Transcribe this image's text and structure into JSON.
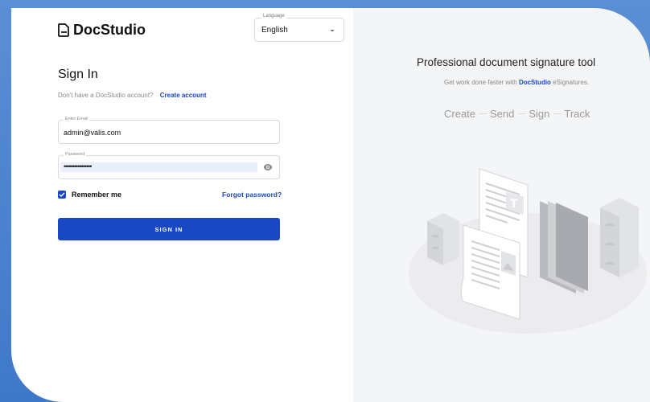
{
  "brand": {
    "name": "DocStudio"
  },
  "language": {
    "label": "Language",
    "value": "English"
  },
  "signin": {
    "title": "Sign In",
    "no_account_text": "Don't have a DocStudio account?",
    "create_account": "Create account",
    "email_label": "Enter Email",
    "email_value": "admin@valis.com",
    "password_label": "Password",
    "password_masked": "••••••••••••••••",
    "remember_me": "Remember me",
    "forgot_password": "Forgot password?",
    "button": "SIGN IN"
  },
  "promo": {
    "title": "Professional document signature tool",
    "subtitle_prefix": "Get work done faster with ",
    "subtitle_brand": "DocStudio",
    "subtitle_suffix": " eSignatures.",
    "steps": [
      "Create",
      "Send",
      "Sign",
      "Track"
    ]
  },
  "icons": {
    "logo": "document-icon",
    "caret": "chevron-down-icon",
    "eye": "eye-icon",
    "check": "check-icon"
  },
  "colors": {
    "accent": "#1a48c4",
    "background": "#4a82cd",
    "panel": "#f4f5f7"
  }
}
